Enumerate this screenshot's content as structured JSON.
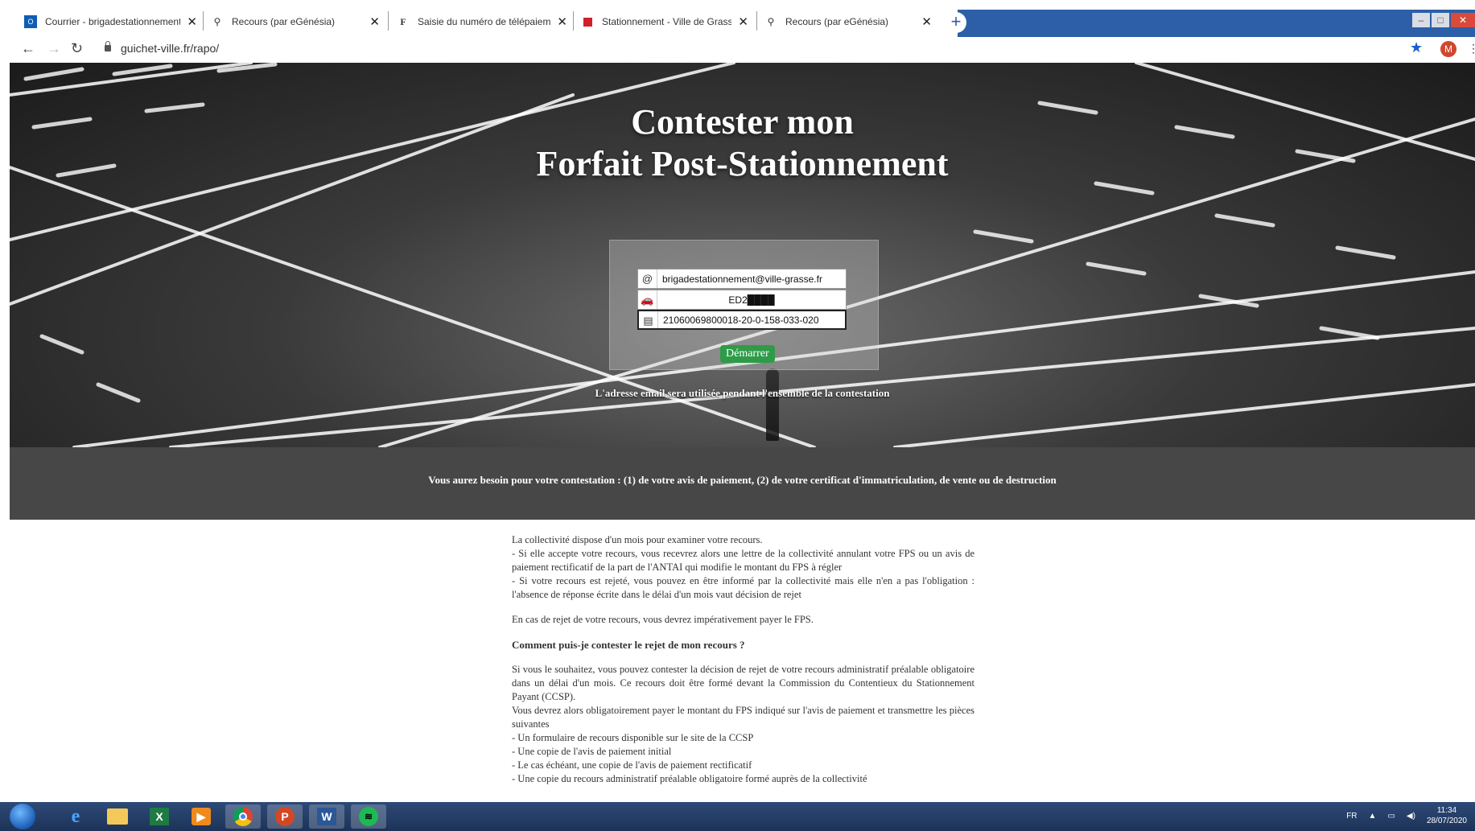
{
  "browser": {
    "tabs": [
      {
        "title": "Courrier - brigadestationnement",
        "icon": "outlook-icon"
      },
      {
        "title": "Recours (par eGénésia)",
        "icon": "location-pin-icon"
      },
      {
        "title": "Saisie du numéro de télépaiement",
        "icon": "f-logo-icon"
      },
      {
        "title": "Stationnement - Ville de Grasse",
        "icon": "red-square-icon"
      },
      {
        "title": "Recours (par eGénésia)",
        "icon": "location-pin-icon"
      }
    ],
    "url": "guichet-ville.fr/rapo/",
    "profile_initial": "M"
  },
  "hero": {
    "title_line1": "Contester mon",
    "title_line2": "Forfait Post-Stationnement",
    "email_value": "brigadestationnement@ville-grasse.fr",
    "plate_value": "ED2████",
    "avis_value": "21060069800018-20-0-158-033-020",
    "start_label": "Démarrer",
    "note": "L'adresse email sera utilisée pendant l'ensemble de la contestation"
  },
  "band": {
    "text": "Vous aurez besoin pour votre contestation : (1) de votre avis de paiement, (2) de votre certificat d'immatriculation, de vente ou de destruction"
  },
  "content": {
    "p1": "La collectivité dispose d'un mois pour examiner votre recours.",
    "p2": "- Si elle accepte votre recours, vous recevrez alors une lettre de la collectivité annulant votre FPS ou un avis de paiement rectificatif de la part de l'ANTAI qui modifie le montant du FPS à régler",
    "p3": "- Si votre recours est rejeté, vous pouvez en être informé par la collectivité mais elle n'en a pas l'obligation : l'absence de réponse écrite dans le délai d'un mois vaut décision de rejet",
    "p4": "En cas de rejet de votre recours, vous devrez impérativement payer le FPS.",
    "heading": "Comment puis-je contester le rejet de mon recours ?",
    "p5": "Si vous le souhaitez, vous pouvez contester la décision de rejet de votre recours administratif préalable obligatoire dans un délai d'un mois. Ce recours doit être formé devant la Commission du Contentieux du Stationnement Payant (CCSP).",
    "p6": "Vous devrez alors obligatoirement payer le montant du FPS indiqué sur l'avis de paiement et transmettre les pièces suivantes",
    "li1": "- Un formulaire de recours disponible sur le site de la CCSP",
    "li2": "- Une copie de l'avis de paiement initial",
    "li3": "- Le cas échéant, une copie de l'avis de paiement rectificatif",
    "li4": "- Une copie du recours administratif préalable obligatoire formé auprès de la collectivité"
  },
  "taskbar": {
    "apps": [
      "internet-explorer-icon",
      "file-explorer-icon",
      "excel-icon",
      "media-player-icon",
      "chrome-icon",
      "powerpoint-icon",
      "word-icon",
      "spotify-icon"
    ],
    "lang": "FR",
    "time": "11:34",
    "date": "28/07/2020"
  },
  "colors": {
    "start_button": "#2e9b48",
    "band": "#474747",
    "taskbar": "#1d3358"
  }
}
